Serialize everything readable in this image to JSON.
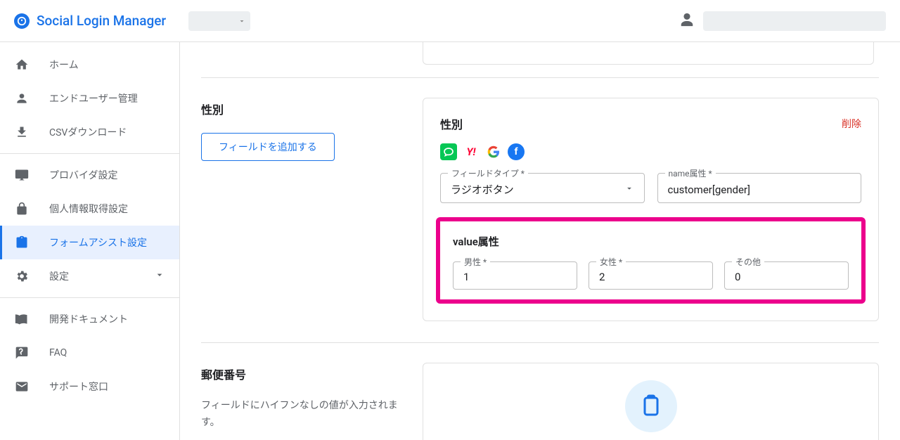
{
  "header": {
    "title": "Social Login Manager"
  },
  "sidebar": {
    "items": [
      {
        "label": "ホーム"
      },
      {
        "label": "エンドユーザー管理"
      },
      {
        "label": "CSVダウンロード"
      },
      {
        "label": "プロバイダ設定"
      },
      {
        "label": "個人情報取得設定"
      },
      {
        "label": "フォームアシスト設定"
      },
      {
        "label": "設定"
      },
      {
        "label": "開発ドキュメント"
      },
      {
        "label": "FAQ"
      },
      {
        "label": "サポート窓口"
      }
    ]
  },
  "gender_section": {
    "left_title": "性別",
    "add_button": "フィールドを追加する",
    "card_title": "性別",
    "delete": "削除",
    "field_type_label": "フィールドタイプ *",
    "field_type_value": "ラジオボタン",
    "name_attr_label": "name属性 *",
    "name_attr_value": "customer[gender]",
    "value_attr_title": "value属性",
    "male_label": "男性 *",
    "male_value": "1",
    "female_label": "女性 *",
    "female_value": "2",
    "other_label": "その他",
    "other_value": "0"
  },
  "postal_section": {
    "title": "郵便番号",
    "desc": "フィールドにハイフンなしの値が入力されます。"
  }
}
